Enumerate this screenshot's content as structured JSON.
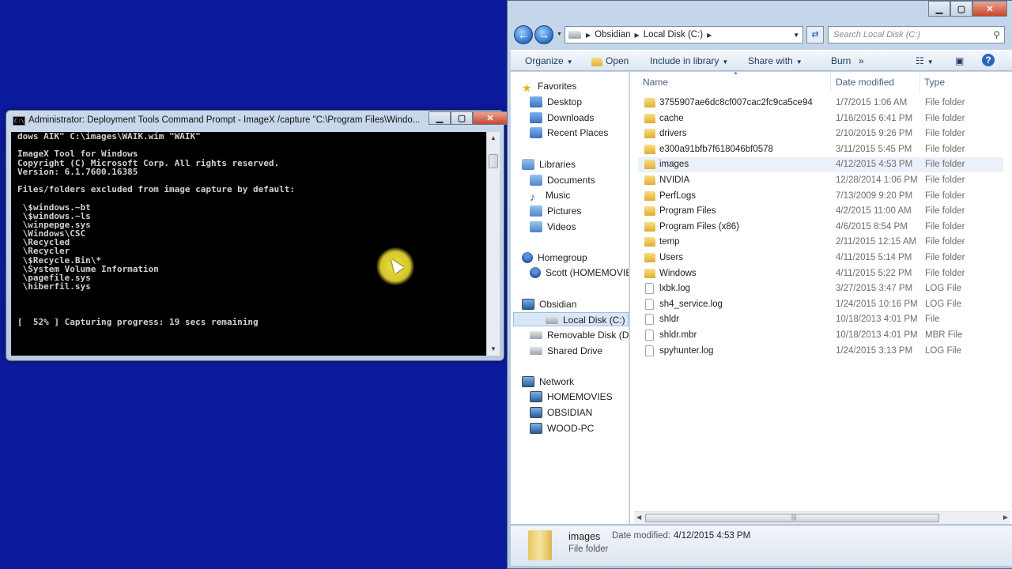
{
  "cmd": {
    "title": "Administrator: Deployment Tools Command Prompt - ImageX  /capture \"C:\\Program Files\\Windo...",
    "lines": [
      "dows AIK\" C:\\images\\WAIK.wim \"WAIK\"",
      "",
      "ImageX Tool for Windows",
      "Copyright (C) Microsoft Corp. All rights reserved.",
      "Version: 6.1.7600.16385",
      "",
      "Files/folders excluded from image capture by default:",
      "",
      " \\$windows.~bt",
      " \\$windows.~ls",
      " \\winpepge.sys",
      " \\Windows\\CSC",
      " \\Recycled",
      " \\Recycler",
      " \\$Recycle.Bin\\*",
      " \\System Volume Information",
      " \\pagefile.sys",
      " \\hiberfil.sys",
      "",
      "",
      "",
      "[  52% ] Capturing progress: 19 secs remaining"
    ]
  },
  "explorer": {
    "address": {
      "crumbs": [
        "Obsidian",
        "Local Disk (C:)"
      ]
    },
    "search_placeholder": "Search Local Disk (C:)",
    "toolbar": {
      "organize": "Organize",
      "open": "Open",
      "include": "Include in library",
      "share": "Share with",
      "burn": "Burn",
      "more": "»"
    },
    "nav": [
      {
        "label": "Favorites",
        "icon": "star-icon",
        "level": 0
      },
      {
        "label": "Desktop",
        "icon": "desktop-icon",
        "level": 1
      },
      {
        "label": "Downloads",
        "icon": "downloads-icon",
        "level": 1
      },
      {
        "label": "Recent Places",
        "icon": "recent-places-icon",
        "level": 1
      },
      {
        "label": "Libraries",
        "icon": "libraries-icon",
        "level": 0
      },
      {
        "label": "Documents",
        "icon": "documents-icon",
        "level": 1
      },
      {
        "label": "Music",
        "icon": "music-icon",
        "level": 1
      },
      {
        "label": "Pictures",
        "icon": "pictures-icon",
        "level": 1
      },
      {
        "label": "Videos",
        "icon": "videos-icon",
        "level": 1
      },
      {
        "label": "Homegroup",
        "icon": "homegroup-icon",
        "level": 0
      },
      {
        "label": "Scott (HOMEMOVIE",
        "icon": "user-icon",
        "level": 1
      },
      {
        "label": "Obsidian",
        "icon": "computer-icon",
        "level": 0
      },
      {
        "label": "Local Disk (C:)",
        "icon": "drive-icon",
        "level": 1
      },
      {
        "label": "Removable Disk (D:)",
        "icon": "removable-drive-icon",
        "level": 1
      },
      {
        "label": "Shared Drive",
        "icon": "drive-icon",
        "level": 1
      },
      {
        "label": "Network",
        "icon": "network-icon",
        "level": 0
      },
      {
        "label": "HOMEMOVIES",
        "icon": "computer-icon",
        "level": 1
      },
      {
        "label": "OBSIDIAN",
        "icon": "computer-icon",
        "level": 1
      },
      {
        "label": "WOOD-PC",
        "icon": "computer-icon",
        "level": 1
      }
    ],
    "columns": {
      "name": "Name",
      "date": "Date modified",
      "type": "Type"
    },
    "files": [
      {
        "name": "3755907ae6dc8cf007cac2fc9ca5ce94",
        "date": "1/7/2015 1:06 AM",
        "type": "File folder",
        "kind": "folder"
      },
      {
        "name": "cache",
        "date": "1/16/2015 6:41 PM",
        "type": "File folder",
        "kind": "folder"
      },
      {
        "name": "drivers",
        "date": "2/10/2015 9:26 PM",
        "type": "File folder",
        "kind": "folder"
      },
      {
        "name": "e300a91bfb7f618046bf0578",
        "date": "3/11/2015 5:45 PM",
        "type": "File folder",
        "kind": "folder"
      },
      {
        "name": "images",
        "date": "4/12/2015 4:53 PM",
        "type": "File folder",
        "kind": "folder"
      },
      {
        "name": "NVIDIA",
        "date": "12/28/2014 1:06 PM",
        "type": "File folder",
        "kind": "folder"
      },
      {
        "name": "PerfLogs",
        "date": "7/13/2009 9:20 PM",
        "type": "File folder",
        "kind": "folder"
      },
      {
        "name": "Program Files",
        "date": "4/2/2015 11:00 AM",
        "type": "File folder",
        "kind": "folder"
      },
      {
        "name": "Program Files (x86)",
        "date": "4/6/2015 8:54 PM",
        "type": "File folder",
        "kind": "folder"
      },
      {
        "name": "temp",
        "date": "2/11/2015 12:15 AM",
        "type": "File folder",
        "kind": "folder"
      },
      {
        "name": "Users",
        "date": "4/11/2015 5:14 PM",
        "type": "File folder",
        "kind": "folder"
      },
      {
        "name": "Windows",
        "date": "4/11/2015 5:22 PM",
        "type": "File folder",
        "kind": "folder"
      },
      {
        "name": "lxbk.log",
        "date": "3/27/2015 3:47 PM",
        "type": "LOG File",
        "kind": "file"
      },
      {
        "name": "sh4_service.log",
        "date": "1/24/2015 10:16 PM",
        "type": "LOG File",
        "kind": "file"
      },
      {
        "name": "shldr",
        "date": "10/18/2013 4:01 PM",
        "type": "File",
        "kind": "file"
      },
      {
        "name": "shldr.mbr",
        "date": "10/18/2013 4:01 PM",
        "type": "MBR File",
        "kind": "file"
      },
      {
        "name": "spyhunter.log",
        "date": "1/24/2015 3:13 PM",
        "type": "LOG File",
        "kind": "file"
      }
    ],
    "details": {
      "name": "images",
      "type": "File folder",
      "date_label": "Date modified:",
      "date_value": "4/12/2015 4:53 PM"
    }
  }
}
